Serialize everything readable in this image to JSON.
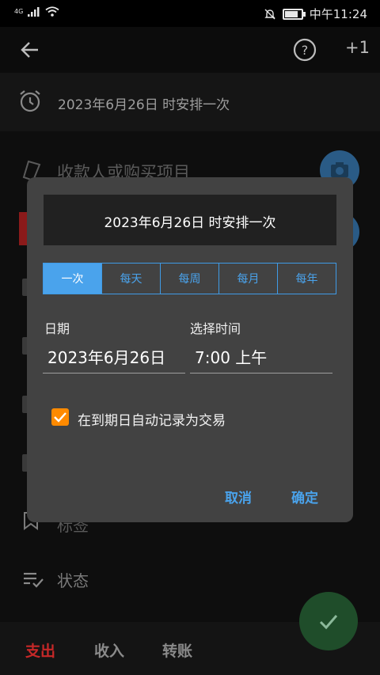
{
  "status_bar": {
    "network": "4G",
    "time": "中午11:24"
  },
  "toolbar": {
    "plus_one": "+1"
  },
  "schedule_row": {
    "text": "2023年6月26日 时安排一次"
  },
  "form": {
    "payee_placeholder": "收款人或购买项目",
    "tags_label": "标签",
    "status_label": "状态"
  },
  "bottom_tabs": {
    "expense": "支出",
    "income": "收入",
    "transfer": "转账"
  },
  "colors": {
    "accent": "#4aa3ec",
    "expense": "#c62828",
    "checkbox": "#ff8a00",
    "dialog_bg": "#424242"
  },
  "dialog": {
    "title": "2023年6月26日 时安排一次",
    "recurrence_options": [
      "一次",
      "每天",
      "每周",
      "每月",
      "每年"
    ],
    "selected_recurrence": "一次",
    "date_label": "日期",
    "date_value": "2023年6月26日",
    "time_label": "选择时间",
    "time_value": "7:00 上午",
    "auto_record_label": "在到期日自动记录为交易",
    "auto_record_checked": true,
    "cancel_label": "取消",
    "confirm_label": "确定"
  }
}
